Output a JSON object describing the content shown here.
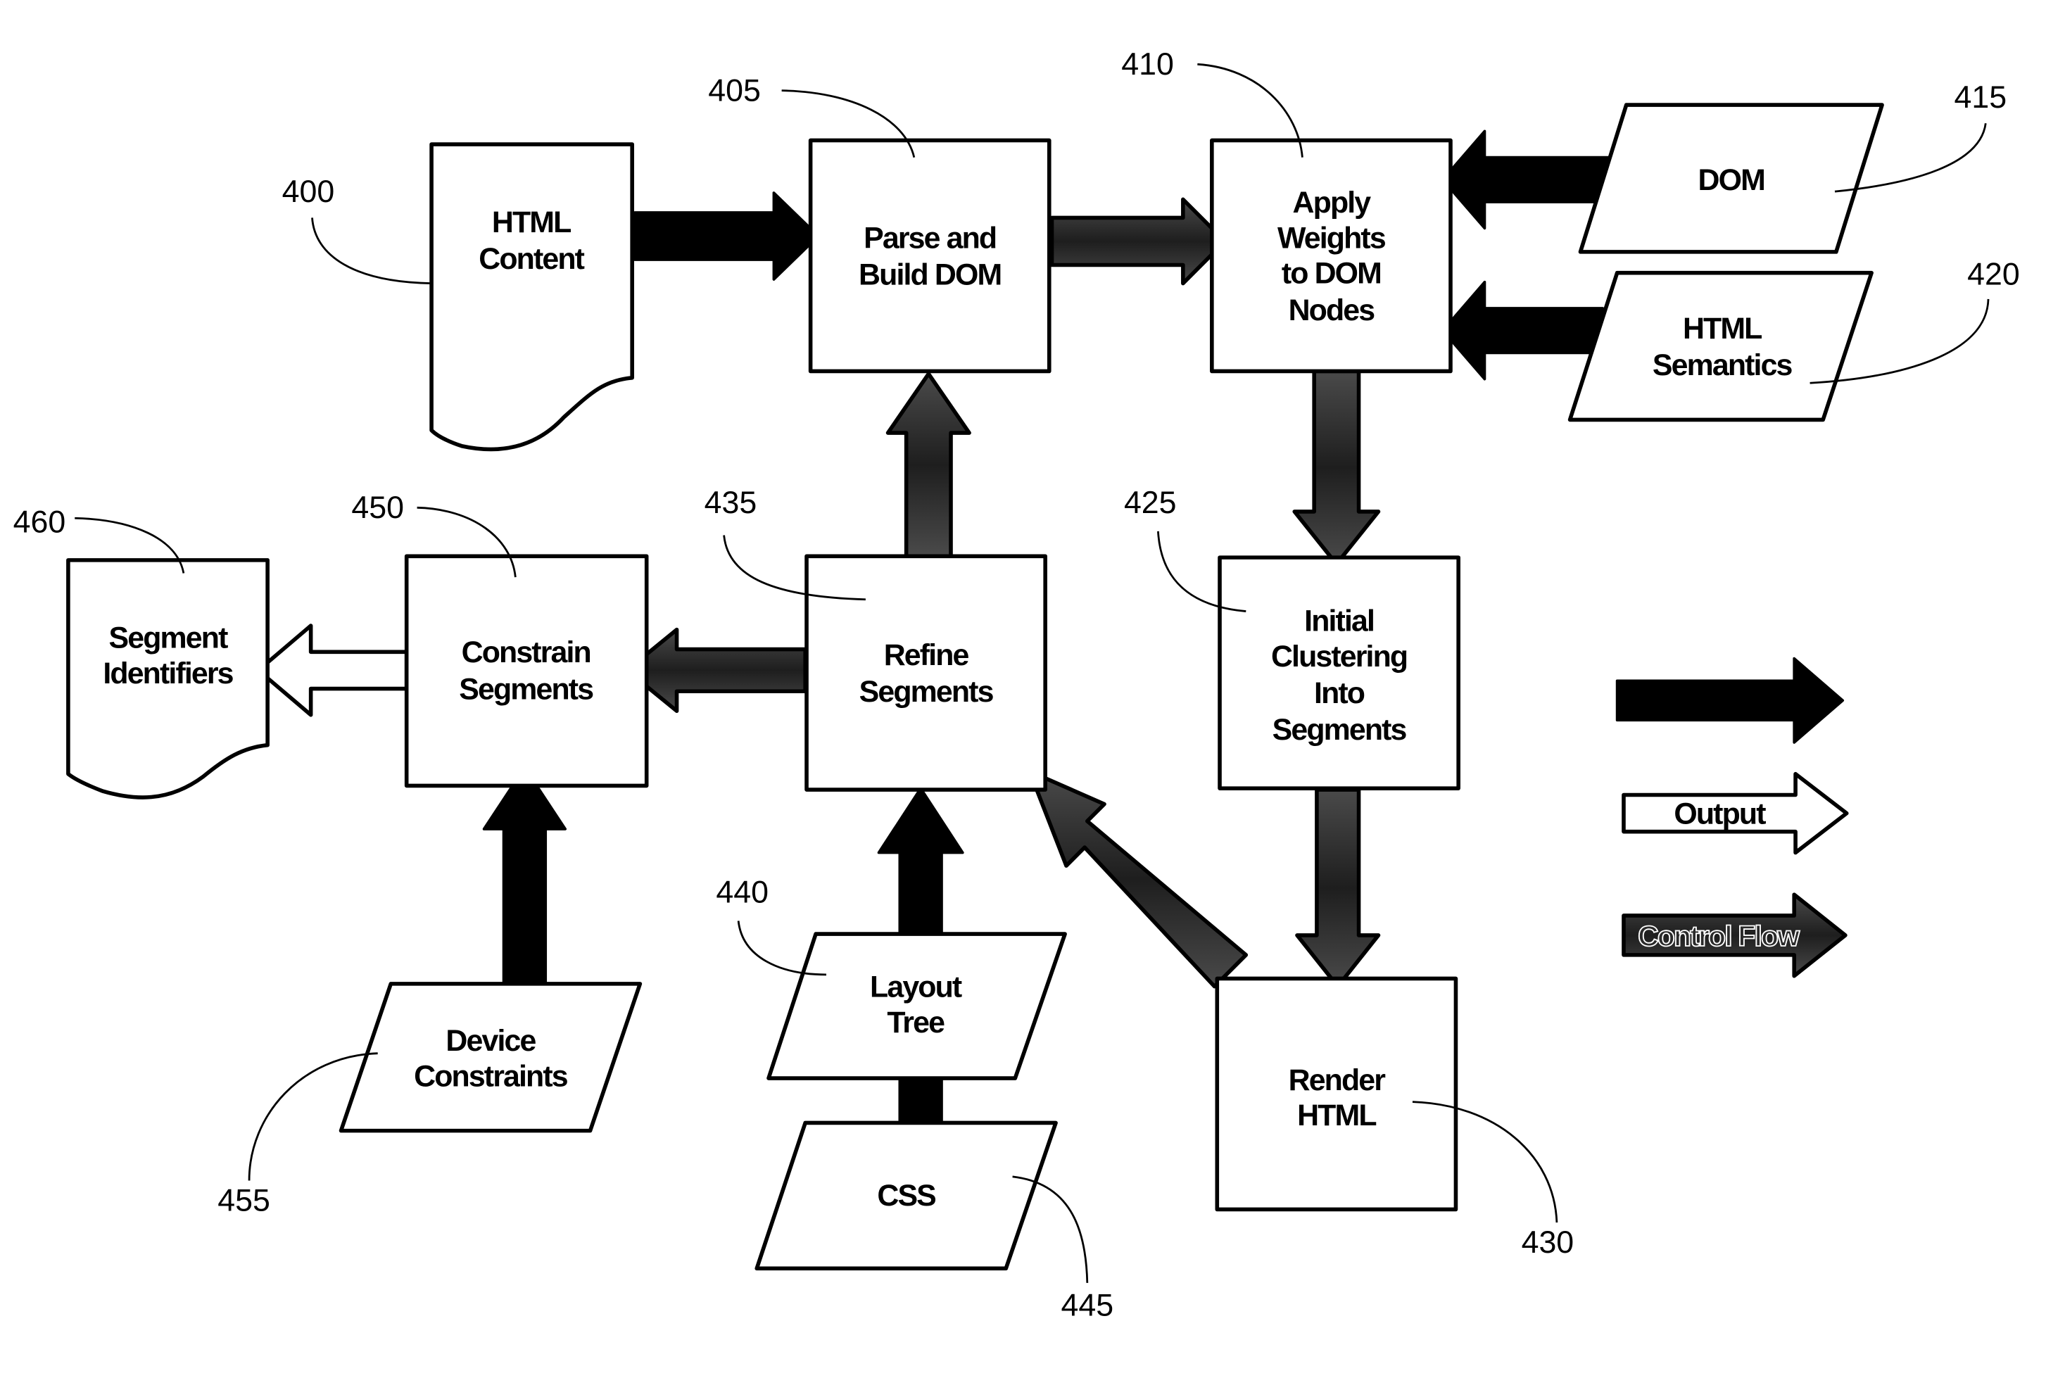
{
  "figure": {
    "nodes": [
      {
        "id": "html-content",
        "ref": "400",
        "shape": "document",
        "lines": [
          "HTML",
          "Content"
        ]
      },
      {
        "id": "parse-build-dom",
        "ref": "405",
        "shape": "process",
        "lines": [
          "Parse and",
          "Build DOM"
        ]
      },
      {
        "id": "apply-weights",
        "ref": "410",
        "shape": "process",
        "lines": [
          "Apply",
          "Weights",
          "to DOM",
          "Nodes"
        ]
      },
      {
        "id": "dom-input",
        "ref": "415",
        "shape": "data",
        "lines": [
          "DOM"
        ]
      },
      {
        "id": "html-semantics",
        "ref": "420",
        "shape": "data",
        "lines": [
          "HTML",
          "Semantics"
        ]
      },
      {
        "id": "initial-clustering",
        "ref": "425",
        "shape": "process",
        "lines": [
          "Initial",
          "Clustering",
          "Into",
          "Segments"
        ]
      },
      {
        "id": "render-html",
        "ref": "430",
        "shape": "process",
        "lines": [
          "Render",
          "HTML"
        ]
      },
      {
        "id": "refine-segments",
        "ref": "435",
        "shape": "process",
        "lines": [
          "Refine",
          "Segments"
        ]
      },
      {
        "id": "layout-tree",
        "ref": "440",
        "shape": "data",
        "lines": [
          "Layout",
          "Tree"
        ]
      },
      {
        "id": "css",
        "ref": "445",
        "shape": "data",
        "lines": [
          "CSS"
        ]
      },
      {
        "id": "constrain-segments",
        "ref": "450",
        "shape": "process",
        "lines": [
          "Constrain",
          "Segments"
        ]
      },
      {
        "id": "device-constraints",
        "ref": "455",
        "shape": "data",
        "lines": [
          "Device",
          "Constraints"
        ]
      },
      {
        "id": "segment-identifiers",
        "ref": "460",
        "shape": "document",
        "lines": [
          "Segment",
          "Identifiers"
        ]
      }
    ],
    "edges": [
      {
        "from": "html-content",
        "to": "parse-build-dom",
        "type": "data"
      },
      {
        "from": "parse-build-dom",
        "to": "apply-weights",
        "type": "control"
      },
      {
        "from": "dom-input",
        "to": "apply-weights",
        "type": "data"
      },
      {
        "from": "html-semantics",
        "to": "apply-weights",
        "type": "data"
      },
      {
        "from": "apply-weights",
        "to": "initial-clustering",
        "type": "control"
      },
      {
        "from": "initial-clustering",
        "to": "render-html",
        "type": "control"
      },
      {
        "from": "render-html",
        "to": "refine-segments",
        "type": "control"
      },
      {
        "from": "refine-segments",
        "to": "parse-build-dom",
        "type": "control"
      },
      {
        "from": "css",
        "to": "layout-tree",
        "type": "data"
      },
      {
        "from": "layout-tree",
        "to": "refine-segments",
        "type": "data"
      },
      {
        "from": "refine-segments",
        "to": "constrain-segments",
        "type": "control"
      },
      {
        "from": "device-constraints",
        "to": "constrain-segments",
        "type": "data"
      },
      {
        "from": "constrain-segments",
        "to": "segment-identifiers",
        "type": "output"
      }
    ],
    "legend": [
      {
        "type": "data",
        "label": ""
      },
      {
        "type": "output",
        "label": "Output"
      },
      {
        "type": "control",
        "label": "Control Flow"
      }
    ],
    "colors": {
      "data_arrow": "#000000",
      "output_arrow": "#ffffff",
      "control_arrow": "#3a3a3a",
      "stroke": "#000000",
      "background": "#ffffff"
    }
  }
}
